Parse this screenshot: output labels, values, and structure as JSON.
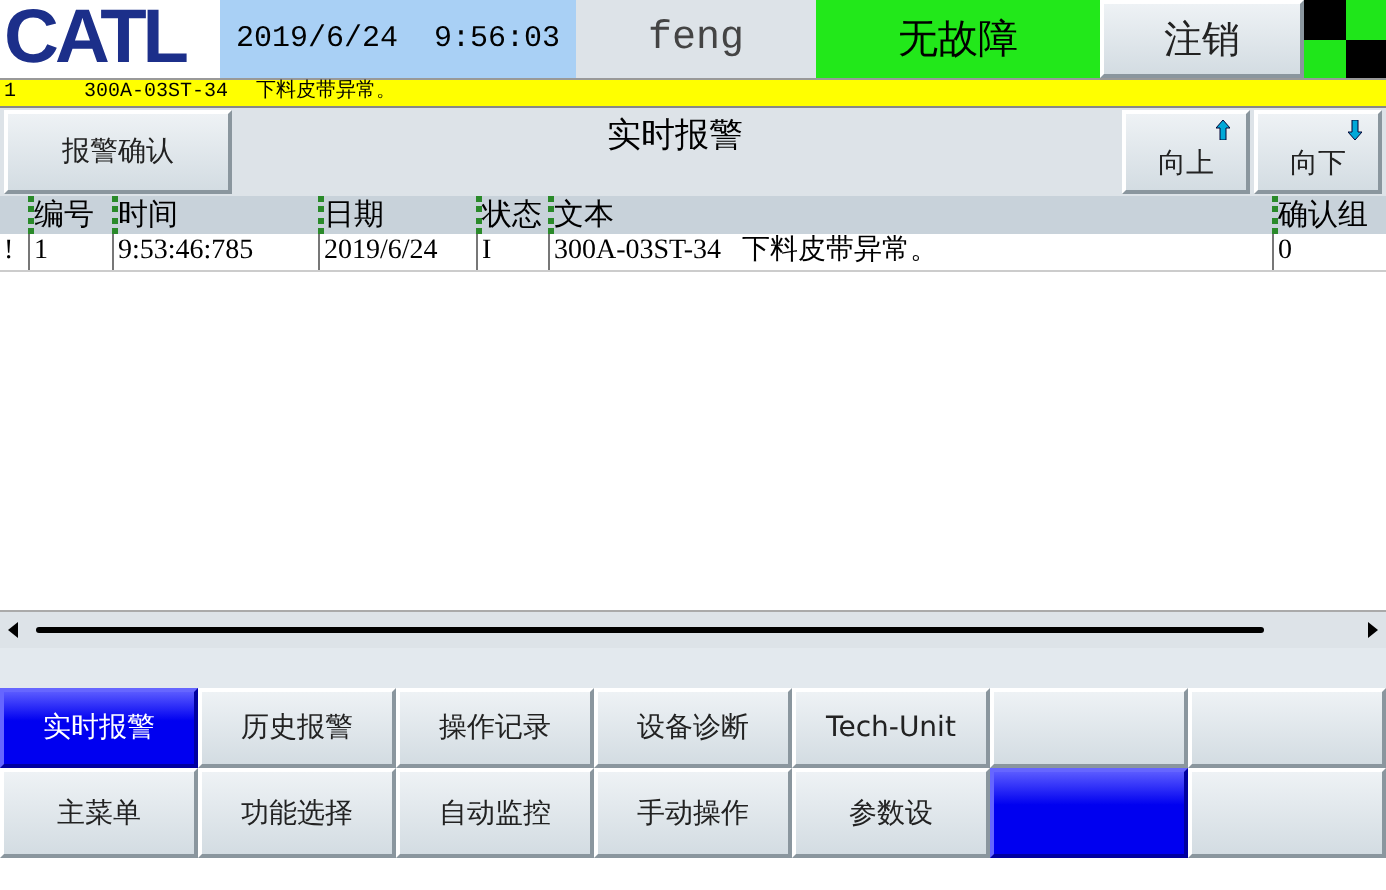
{
  "header": {
    "logo": "CATL",
    "datetime": "2019/6/24  9:56:03",
    "user": "feng",
    "status": "无故障",
    "logout": "注销"
  },
  "ticker": {
    "number": "1",
    "source": "300A-03ST-34",
    "message": "下料皮带异常。"
  },
  "toolbar": {
    "ack_button": "报警确认",
    "title": "实时报警",
    "up_button": "向上",
    "down_button": "向下"
  },
  "table": {
    "columns": [
      "编号",
      "时间",
      "日期",
      "状态",
      "文本",
      "确认组"
    ],
    "rows": [
      {
        "flag": "!",
        "cells": [
          "1",
          "9:53:46:785",
          "2019/6/24",
          "I",
          "300A-03ST-34   下料皮带异常。",
          "0"
        ]
      }
    ]
  },
  "tabs": [
    {
      "label": "实时报警",
      "selected": true
    },
    {
      "label": "历史报警",
      "selected": false
    },
    {
      "label": "操作记录",
      "selected": false
    },
    {
      "label": "设备诊断",
      "selected": false
    },
    {
      "label": "Tech-Unit",
      "selected": false
    },
    {
      "selected": false
    },
    {
      "selected": false
    }
  ],
  "menu": [
    {
      "label": "主菜单",
      "selected": false
    },
    {
      "label": "功能选择",
      "selected": false
    },
    {
      "label": "自动监控",
      "selected": false
    },
    {
      "label": "手动操作",
      "selected": false
    },
    {
      "label": "参数设",
      "selected": false
    },
    {
      "selected": true
    },
    {
      "selected": false
    }
  ]
}
